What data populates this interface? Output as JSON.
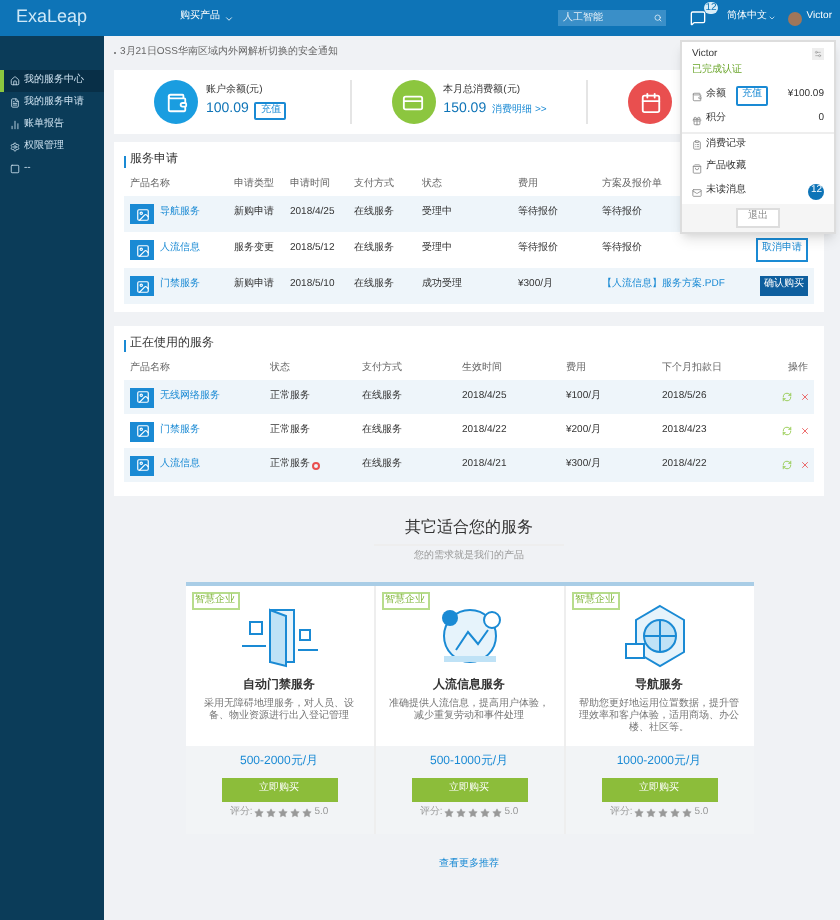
{
  "header": {
    "logo": "ExaLeap",
    "product_menu": "购买产品",
    "search": {
      "placeholder": "人工智能"
    },
    "message_badge": "12",
    "language": "简体中文",
    "user": "Victor"
  },
  "sidebar": {
    "items": [
      {
        "label": "我的服务中心",
        "selected": true
      },
      {
        "label": "我的服务申请",
        "selected": false
      },
      {
        "label": "账单报告",
        "selected": false
      },
      {
        "label": "权限管理",
        "selected": false
      },
      {
        "label": "--",
        "selected": false
      }
    ]
  },
  "notice": "3月21日OSS华南区域内外网解析切换的安全通知",
  "stats": [
    {
      "kind": "balance",
      "label": "账户余额(元)",
      "value": "100.09",
      "action": "充值"
    },
    {
      "kind": "spend",
      "label": "本月总消费额(元)",
      "value": "150.09",
      "action": "消费明细 >>"
    },
    {
      "kind": "bill"
    }
  ],
  "applications": {
    "title": "服务申请",
    "columns": [
      "产品名称",
      "申请类型",
      "申请时间",
      "支付方式",
      "状态",
      "费用",
      "方案及报价单"
    ],
    "rows": [
      {
        "cells": [
          "导航服务",
          "新购申请",
          "2018/4/25",
          "在线服务",
          "受理中",
          "等待报价",
          "等待报价"
        ]
      },
      {
        "cells": [
          "人流信息",
          "服务变更",
          "2018/5/12",
          "在线服务",
          "受理中",
          "等待报价",
          "等待报价"
        ],
        "action": {
          "kind": "cancel",
          "label": "取消申请"
        }
      },
      {
        "cells": [
          "门禁服务",
          "新购申请",
          "2018/5/10",
          "在线服务",
          "成功受理",
          "¥300/月",
          "【人流信息】服务方案.PDF"
        ],
        "action": {
          "kind": "confirm",
          "label": "确认购买"
        }
      }
    ]
  },
  "active_services": {
    "title": "正在使用的服务",
    "columns": [
      "产品名称",
      "状态",
      "支付方式",
      "生效时间",
      "费用",
      "下个月扣款日",
      "操作"
    ],
    "rows": [
      {
        "cells": [
          "无线网络服务",
          "正常服务",
          "在线服务",
          "2018/4/25",
          "¥100/月",
          "2018/5/26"
        ],
        "warning": false
      },
      {
        "cells": [
          "门禁服务",
          "正常服务",
          "在线服务",
          "2018/4/22",
          "¥200/月",
          "2018/4/23"
        ],
        "warning": false
      },
      {
        "cells": [
          "人流信息",
          "正常服务",
          "在线服务",
          "2018/4/21",
          "¥300/月",
          "2018/4/22"
        ],
        "warning": true
      }
    ]
  },
  "recommendations": {
    "title": "其它适合您的服务",
    "subtitle": "您的需求就是我们的产品",
    "cards": [
      {
        "kind": "door",
        "tag": "智慧企业",
        "name": "自动门禁服务",
        "description": "采用无障碍地理服务，对人员、设备、物业资源进行出入登记管理",
        "price": "500-2000元/月",
        "button": "立即购买",
        "rating_label": "评分:",
        "stars": 5,
        "score": "5.0"
      },
      {
        "kind": "people",
        "tag": "智慧企业",
        "name": "人流信息服务",
        "description": "准确提供人流信息，提高用户体验，减少重复劳动和事件处理",
        "price": "500-1000元/月",
        "button": "立即购买",
        "rating_label": "评分:",
        "stars": 5,
        "score": "5.0"
      },
      {
        "kind": "navigation",
        "tag": "智慧企业",
        "name": "导航服务",
        "description": "帮助您更好地运用位置数据，提升管理效率和客户体验，适用商场、办公楼、社区等。",
        "price": "1000-2000元/月",
        "button": "立即购买",
        "rating_label": "评分:",
        "stars": 5,
        "score": "5.0"
      }
    ],
    "more": "查看更多推荐"
  },
  "user_menu": {
    "name": "Victor",
    "status": "已完成认证",
    "items": [
      {
        "kind": "balance",
        "label": "余额",
        "action": "充值",
        "value": "¥100.09"
      },
      {
        "kind": "points",
        "label": "积分",
        "value": "0"
      },
      {
        "kind": "link",
        "label": "消费记录"
      },
      {
        "kind": "link",
        "label": "产品收藏"
      },
      {
        "kind": "messages",
        "label": "未读消息",
        "badge": "12"
      }
    ],
    "logout": "退出"
  }
}
